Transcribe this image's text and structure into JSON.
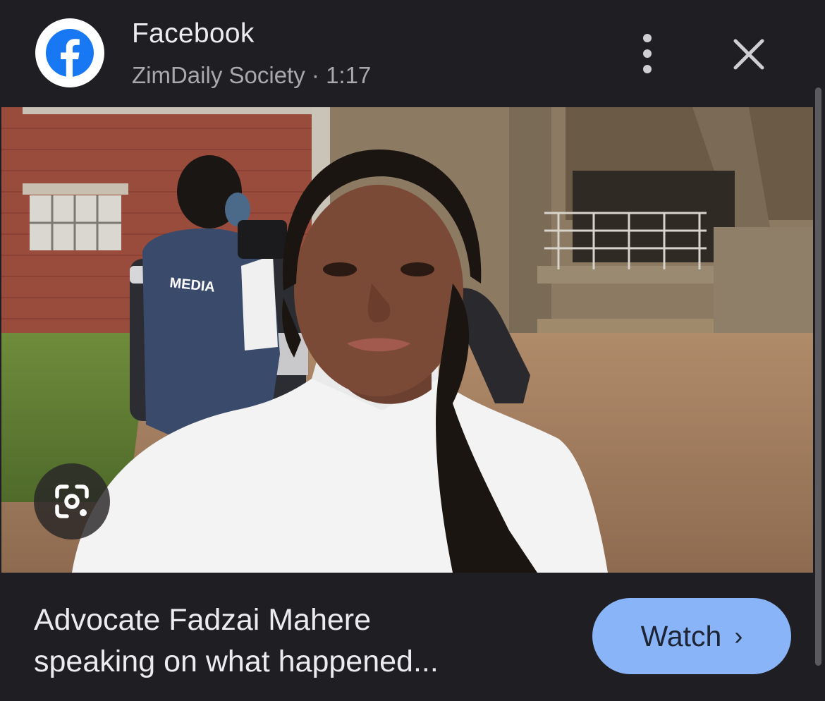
{
  "header": {
    "title": "Facebook",
    "source": "ZimDaily Society",
    "separator": "·",
    "duration": "1:17",
    "logo_icon": "facebook-icon",
    "brand_color": "#1877f2",
    "menu_icon": "more-vert-icon",
    "close_icon": "close-icon"
  },
  "media": {
    "vest_text": "MEDIA",
    "lens_icon": "google-lens-icon"
  },
  "footer": {
    "caption_line1": "Advocate Fadzai Mahere",
    "caption_line2": "speaking on what happened...",
    "watch_label": "Watch",
    "watch_chevron": "›",
    "accent_color": "#8ab4f8"
  }
}
